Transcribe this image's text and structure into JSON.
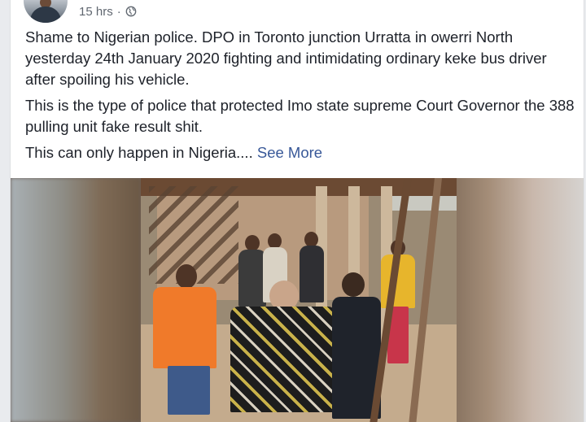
{
  "post": {
    "time": "15 hrs",
    "separator": "·",
    "privacy_icon": "globe-icon",
    "paragraphs": [
      "Shame to Nigerian police. DPO in Toronto junction Urratta in owerri North yesterday 24th January 2020 fighting and intimidating ordinary keke bus driver after spoiling his vehicle.",
      "This is the type of police that protected Imo state supreme Court Governor the 388 pulling unit fake result shit.",
      "This can only happen in Nigeria...."
    ],
    "see_more": "See More"
  },
  "colors": {
    "link": "#385898",
    "text": "#1d2129",
    "meta": "#606770",
    "background": "#e9ebee"
  }
}
